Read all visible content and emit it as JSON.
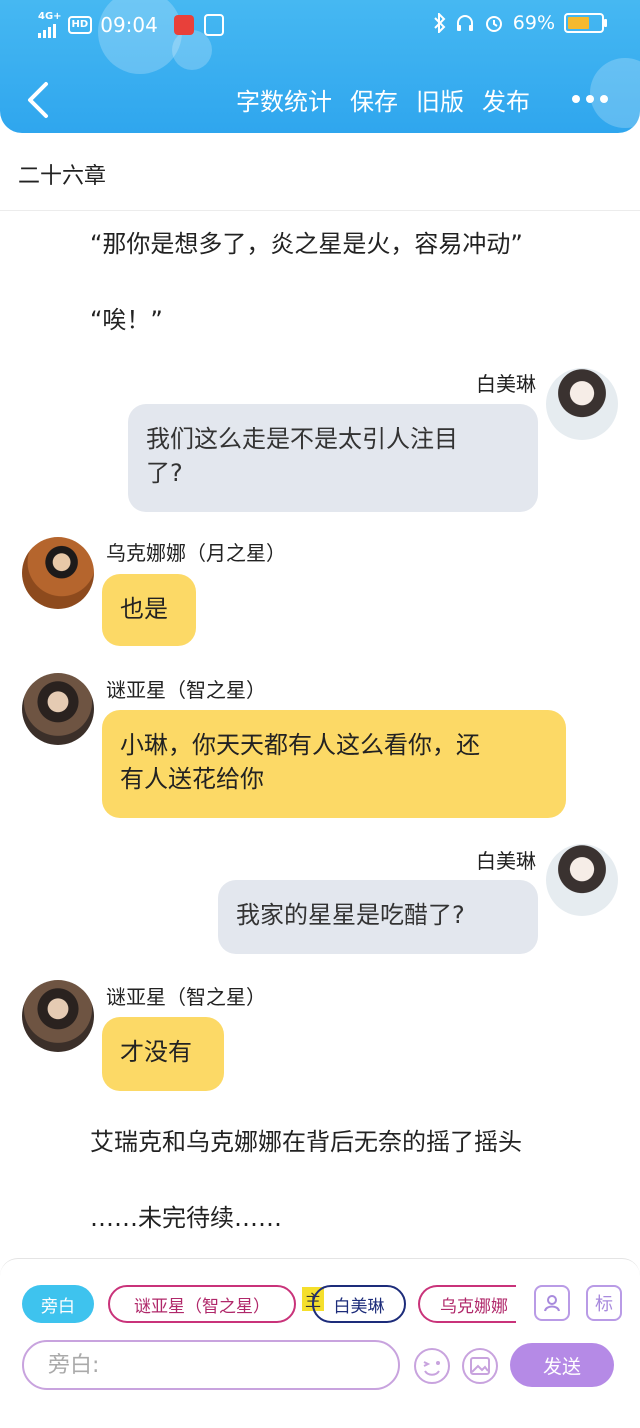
{
  "status_bar": {
    "network": "4G+",
    "hd": "HD",
    "time": "09:04",
    "battery_text": "69%",
    "battery_level": 0.69
  },
  "header": {
    "nav": [
      "字数统计",
      "保存",
      "旧版",
      "发布"
    ],
    "colors": {
      "accent": "#2fa6ee"
    }
  },
  "chapter_title": "二十六章",
  "messages": [
    {
      "type": "narration",
      "text": "“那你是想多了，炎之星是火，容易冲动”"
    },
    {
      "type": "narration",
      "text": "“唉！”"
    },
    {
      "type": "chat",
      "side": "right",
      "speaker": "白美琳",
      "lines": [
        "我们这么走是不是太引人注目",
        "了?"
      ]
    },
    {
      "type": "chat",
      "side": "left",
      "speaker": "乌克娜娜（月之星）",
      "lines": [
        "也是"
      ]
    },
    {
      "type": "chat",
      "side": "left",
      "speaker": "谜亚星（智之星）",
      "lines": [
        "小琳，你天天都有人这么看你，还",
        "有人送花给你"
      ]
    },
    {
      "type": "chat",
      "side": "right",
      "speaker": "白美琳",
      "lines": [
        "我家的星星是吃醋了?"
      ]
    },
    {
      "type": "chat",
      "side": "left",
      "speaker": "谜亚星（智之星）",
      "lines": [
        "才没有"
      ]
    },
    {
      "type": "narration",
      "text": "艾瑞克和乌克娜娜在背后无奈的摇了摇头"
    },
    {
      "type": "narration",
      "text": "……未完待续……"
    }
  ],
  "roles": [
    {
      "label": "旁白",
      "style": "active"
    },
    {
      "label": "谜亚星（智之星）",
      "style": "pink"
    },
    {
      "label": "白美琳",
      "style": "navy",
      "tag": "主"
    },
    {
      "label": "乌克娜娜",
      "style": "pink"
    }
  ],
  "tools": {
    "role_icon": "person-card-icon",
    "mark_label": "标"
  },
  "input": {
    "placeholder": "旁白:"
  },
  "send_label": "发送"
}
